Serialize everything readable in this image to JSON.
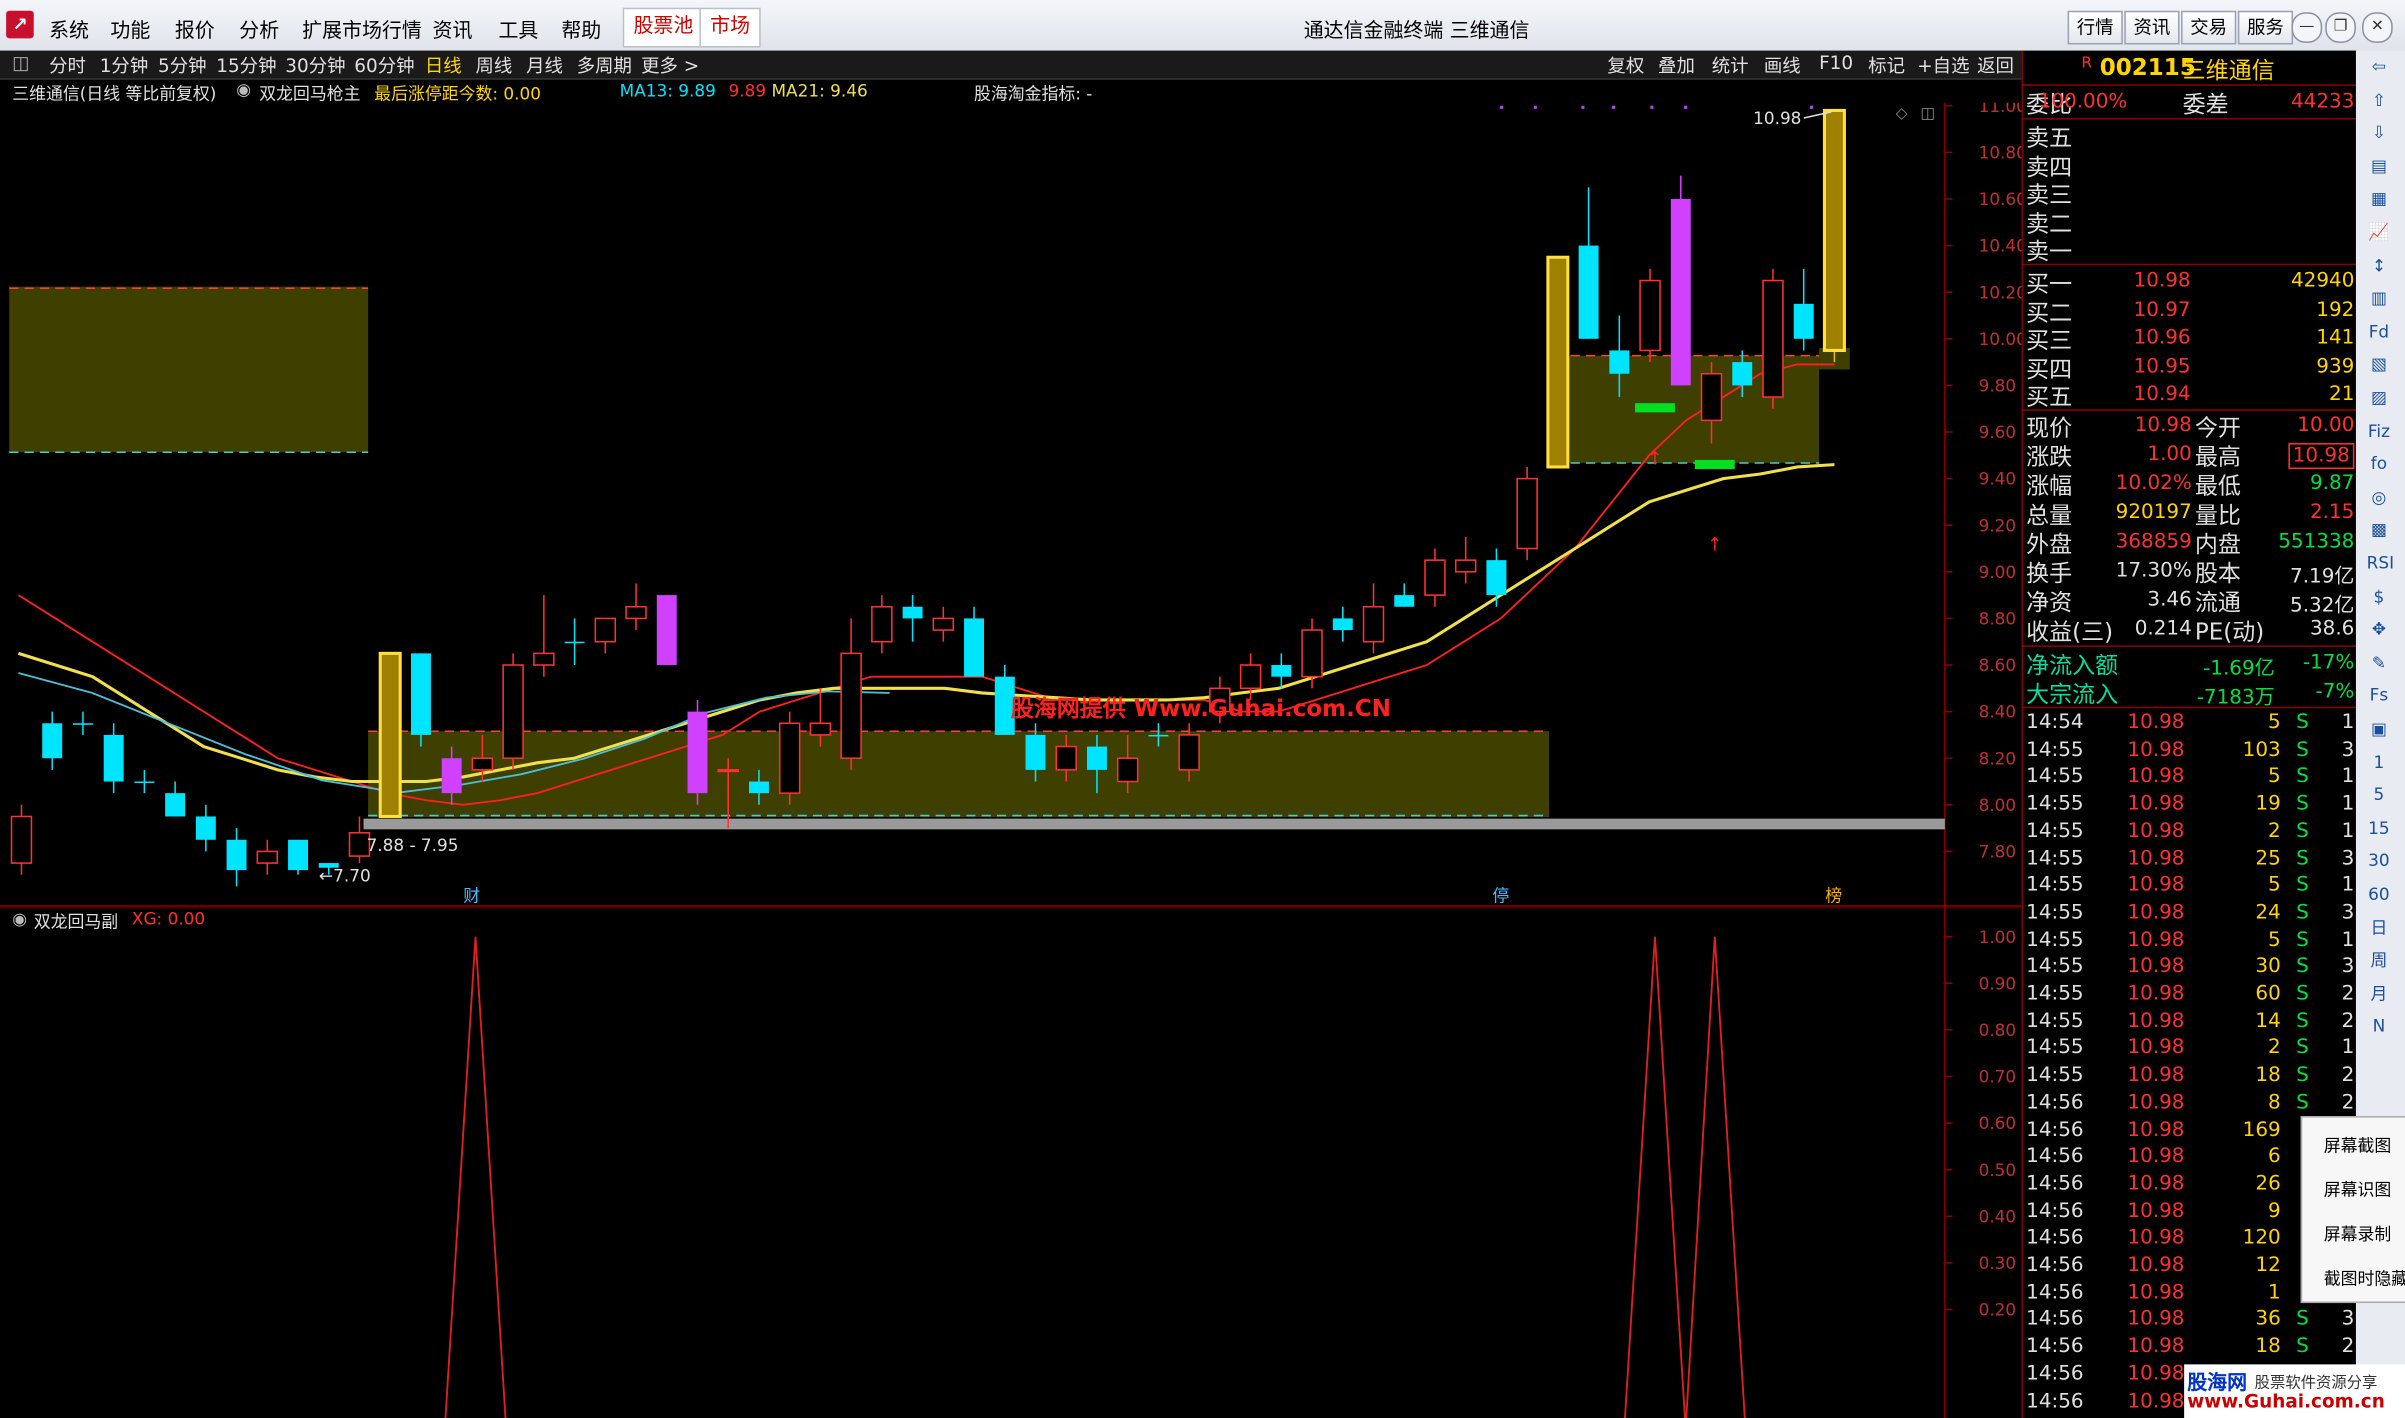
{
  "window": {
    "title": "通达信金融终端 三维通信",
    "menu": [
      "系统",
      "功能",
      "报价",
      "分析",
      "扩展市场行情",
      "资讯",
      "工具",
      "帮助"
    ],
    "highlight_menu": [
      "股票池",
      "市场"
    ],
    "toolbar_right": [
      "行情",
      "资讯",
      "交易",
      "服务"
    ]
  },
  "period_tabs": [
    "分时",
    "1分钟",
    "5分钟",
    "15分钟",
    "30分钟",
    "60分钟",
    "日线",
    "周线",
    "月线",
    "多周期",
    "更多 >"
  ],
  "active_period": "日线",
  "chart_tools": [
    "复权",
    "叠加",
    "统计",
    "画线",
    "F10",
    "标记",
    "+自选",
    "返回"
  ],
  "info": {
    "name": "三维通信(日线 等比前复权)",
    "indicator": "双龙回马枪主",
    "limit_label": "最后涨停距今数: 0.00",
    "ma13_label": "MA13: 9.89",
    "ma13_val2": "9.89",
    "ma21_label": "MA21: 9.46",
    "gh_label": "股海淘金指标: -"
  },
  "sub_info": {
    "name": "双龙回马副",
    "xg": "XG: 0.00"
  },
  "annotations": {
    "high": "10.98",
    "range": "7.88 - 7.95",
    "low": "←7.70",
    "m1": "财",
    "m2": "停",
    "m3": "榜",
    "watermark": "股海网提供 Www.Guhai.com.CN"
  },
  "y_axis_main": [
    "11.00",
    "10.80",
    "10.60",
    "10.40",
    "10.20",
    "10.00",
    "9.80",
    "9.60",
    "9.40",
    "9.20",
    "9.00",
    "8.80",
    "8.60",
    "8.40",
    "8.20",
    "8.00",
    "7.80"
  ],
  "y_axis_sub": [
    "1.00",
    "0.90",
    "0.80",
    "0.70",
    "0.60",
    "0.50",
    "0.40",
    "0.30",
    "0.20"
  ],
  "quote": {
    "code": "002115",
    "name": "三维通信",
    "weibi_label": "委比",
    "weibi": "100.00%",
    "weicha_label": "委差",
    "weicha": "44233",
    "sell": [
      {
        "label": "卖五"
      },
      {
        "label": "卖四"
      },
      {
        "label": "卖三"
      },
      {
        "label": "卖二"
      },
      {
        "label": "卖一"
      }
    ],
    "buy": [
      {
        "label": "买一",
        "price": "10.98",
        "vol": "42940"
      },
      {
        "label": "买二",
        "price": "10.97",
        "vol": "192"
      },
      {
        "label": "买三",
        "price": "10.96",
        "vol": "141"
      },
      {
        "label": "买四",
        "price": "10.95",
        "vol": "939"
      },
      {
        "label": "买五",
        "price": "10.94",
        "vol": "21"
      }
    ],
    "stats": [
      [
        "现价",
        "10.98",
        "今开",
        "10.00"
      ],
      [
        "涨跌",
        "1.00",
        "最高",
        "10.98"
      ],
      [
        "涨幅",
        "10.02%",
        "最低",
        "9.87"
      ],
      [
        "总量",
        "920197",
        "量比",
        "2.15"
      ],
      [
        "外盘",
        "368859",
        "内盘",
        "551338"
      ],
      [
        "换手",
        "17.30%",
        "股本",
        "7.19亿"
      ],
      [
        "净资",
        "3.46",
        "流通",
        "5.32亿"
      ],
      [
        "收益(三)",
        "0.214",
        "PE(动)",
        "38.6"
      ]
    ],
    "flow": [
      [
        "净流入额",
        "-1.69亿",
        "-17%"
      ],
      [
        "大宗流入",
        "-7183万",
        "-7%"
      ]
    ]
  },
  "ticks": [
    [
      "14:54",
      "10.98",
      "5",
      "S",
      "1"
    ],
    [
      "14:55",
      "10.98",
      "103",
      "S",
      "3"
    ],
    [
      "14:55",
      "10.98",
      "5",
      "S",
      "1"
    ],
    [
      "14:55",
      "10.98",
      "19",
      "S",
      "1"
    ],
    [
      "14:55",
      "10.98",
      "2",
      "S",
      "1"
    ],
    [
      "14:55",
      "10.98",
      "25",
      "S",
      "3"
    ],
    [
      "14:55",
      "10.98",
      "5",
      "S",
      "1"
    ],
    [
      "14:55",
      "10.98",
      "24",
      "S",
      "3"
    ],
    [
      "14:55",
      "10.98",
      "5",
      "S",
      "1"
    ],
    [
      "14:55",
      "10.98",
      "30",
      "S",
      "3"
    ],
    [
      "14:55",
      "10.98",
      "60",
      "S",
      "2"
    ],
    [
      "14:55",
      "10.98",
      "14",
      "S",
      "2"
    ],
    [
      "14:55",
      "10.98",
      "2",
      "S",
      "1"
    ],
    [
      "14:55",
      "10.98",
      "18",
      "S",
      "2"
    ],
    [
      "14:56",
      "10.98",
      "8",
      "S",
      "2"
    ],
    [
      "14:56",
      "10.98",
      "169",
      "",
      " "
    ],
    [
      "14:56",
      "10.98",
      "6",
      "",
      " "
    ],
    [
      "14:56",
      "10.98",
      "26",
      "",
      " "
    ],
    [
      "14:56",
      "10.98",
      "9",
      "",
      " "
    ],
    [
      "14:56",
      "10.98",
      "120",
      "",
      " "
    ],
    [
      "14:56",
      "10.98",
      "12",
      "",
      " "
    ],
    [
      "14:56",
      "10.98",
      "1",
      "",
      " "
    ],
    [
      "14:56",
      "10.98",
      "36",
      "S",
      "3"
    ],
    [
      "14:56",
      "10.98",
      "18",
      "S",
      "2"
    ],
    [
      "14:56",
      "10.98",
      "",
      "",
      " "
    ],
    [
      "14:56",
      "10.98",
      "",
      "",
      " "
    ]
  ],
  "side_toolbar": [
    "⇦",
    "⇧",
    "⇩",
    "▤",
    "▦",
    "📈",
    "↕",
    "▥",
    "Fd",
    "▧",
    "▨",
    "Fiz",
    "fo",
    "◎",
    "▩",
    "RSI",
    "$",
    "✥",
    "✎",
    "Fs",
    "▣",
    "1",
    "5",
    "15",
    "30",
    "60",
    "日",
    "周",
    "月",
    "N"
  ],
  "popup": [
    "屏幕截图",
    "屏幕识图",
    "屏幕录制",
    "截图时隐藏"
  ],
  "brand": {
    "name": "股海网",
    "slogan": "股票软件资源分享",
    "url": "www.Guhai.com.cn"
  },
  "colors": {
    "up": "#ff3232",
    "down": "#00e5ff",
    "ma13": "#ff2020",
    "ma21": "#f0e04a",
    "zone": "#4a4a00"
  },
  "chart_data": [
    {
      "type": "candlestick",
      "title": "",
      "ylim": [
        7.6,
        11.05
      ],
      "series": [
        {
          "name": "MA13",
          "values": [
            8.9,
            8.8,
            8.7,
            8.6,
            8.5,
            8.4,
            8.3,
            8.2,
            8.15,
            8.1,
            8.05,
            8.02,
            8.0,
            8.02,
            8.05,
            8.1,
            8.15,
            8.2,
            8.25,
            8.3,
            8.4,
            8.45,
            8.5,
            8.55,
            8.55,
            8.55,
            8.55,
            8.5,
            8.45,
            8.45,
            8.45,
            8.45,
            8.45,
            8.4,
            8.4,
            8.45,
            8.5,
            8.55,
            8.6,
            8.7,
            8.8,
            8.95,
            9.1,
            9.3,
            9.5,
            9.65,
            9.75,
            9.85,
            9.89,
            9.89
          ]
        },
        {
          "name": "MA21",
          "values": [
            8.65,
            8.6,
            8.55,
            8.45,
            8.35,
            8.25,
            8.2,
            8.15,
            8.12,
            8.1,
            8.1,
            8.1,
            8.12,
            8.15,
            8.18,
            8.2,
            8.25,
            8.3,
            8.35,
            8.4,
            8.45,
            8.48,
            8.5,
            8.5,
            8.5,
            8.5,
            8.48,
            8.47,
            8.46,
            8.45,
            8.45,
            8.45,
            8.46,
            8.48,
            8.5,
            8.55,
            8.6,
            8.65,
            8.7,
            8.8,
            8.9,
            9.0,
            9.1,
            9.2,
            9.3,
            9.35,
            9.4,
            9.42,
            9.45,
            9.46
          ]
        }
      ]
    },
    {
      "type": "line",
      "title": "",
      "ylim": [
        0,
        1
      ],
      "series": [
        {
          "name": "XG",
          "peaks": [
            1,
            1,
            1
          ]
        }
      ]
    }
  ]
}
